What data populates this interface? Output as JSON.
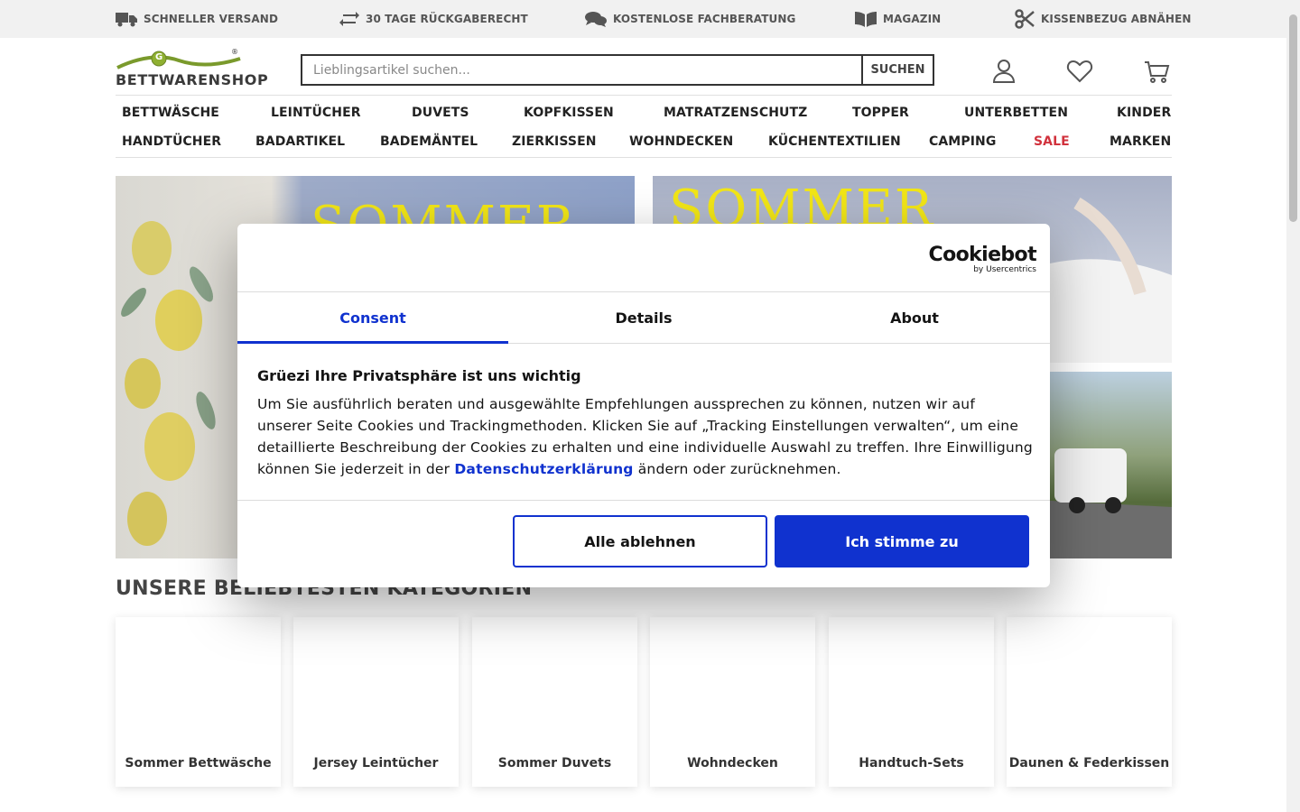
{
  "topbar": {
    "items": [
      {
        "label": "SCHNELLER VERSAND",
        "icon": "truck-icon"
      },
      {
        "label": "30 TAGE RÜCKGABERECHT",
        "icon": "exchange-arrows-icon"
      },
      {
        "label": "KOSTENLOSE FACHBERATUNG",
        "icon": "chat-bubbles-icon"
      },
      {
        "label": "MAGAZIN",
        "icon": "open-book-icon"
      },
      {
        "label": "KISSENBEZUG ABNÄHEN",
        "icon": "scissors-icon"
      }
    ]
  },
  "header": {
    "logo_text": "BETTWARENSHOP",
    "logo_mark": "G",
    "logo_registered": "®",
    "search_placeholder": "Lieblingsartikel suchen...",
    "search_button": "SUCHEN",
    "icons": [
      "user-icon",
      "heart-icon",
      "cart-icon"
    ]
  },
  "nav": {
    "row1": [
      "BETTWÄSCHE",
      "LEINTÜCHER",
      "DUVETS",
      "KOPFKISSEN",
      "MATRATZENSCHUTZ",
      "TOPPER",
      "UNTERBETTEN",
      "KINDER"
    ],
    "row2": [
      "HANDTÜCHER",
      "BADARTIKEL",
      "BADEMÄNTEL",
      "ZIERKISSEN",
      "WOHNDECKEN",
      "KÜCHENTEXTILIEN",
      "CAMPING",
      "SALE",
      "MARKEN"
    ]
  },
  "hero": {
    "left_headline": "SOMMER",
    "right_headline": "SOMMER"
  },
  "categories": {
    "title": "UNSERE BELIEBTESTEN KATEGORIEN",
    "items": [
      "Sommer Bettwäsche",
      "Jersey Leintücher",
      "Sommer Duvets",
      "Wohndecken",
      "Handtuch-Sets",
      "Daunen & Federkissen"
    ]
  },
  "cookie_dialog": {
    "brand": "Cookiebot",
    "brand_sub": "by Usercentrics",
    "tabs": [
      "Consent",
      "Details",
      "About"
    ],
    "active_tab": "Consent",
    "heading": "Grüezi Ihre Privatsphäre ist uns wichtig",
    "body_before_link": "Um Sie ausführlich beraten und ausgewählte Empfehlungen aussprechen zu können, nutzen wir auf unserer Seite Cookies und Trackingmethoden. Klicken Sie auf „Tracking Einstellungen verwalten“, um eine detaillierte Beschreibung der Cookies zu erhalten und eine individuelle Auswahl zu treffen. Ihre Einwilligung können Sie jederzeit in der ",
    "link_text": "Datenschutzerklärung",
    "body_after_link": " ändern oder zurücknehmen.",
    "deny_button": "Alle ablehnen",
    "accept_button": "Ich stimme zu"
  },
  "colors": {
    "accent": "#1032cf",
    "sale": "#d1323d",
    "logo_green": "#7a9a2c",
    "headline_yellow": "#f2e617"
  }
}
